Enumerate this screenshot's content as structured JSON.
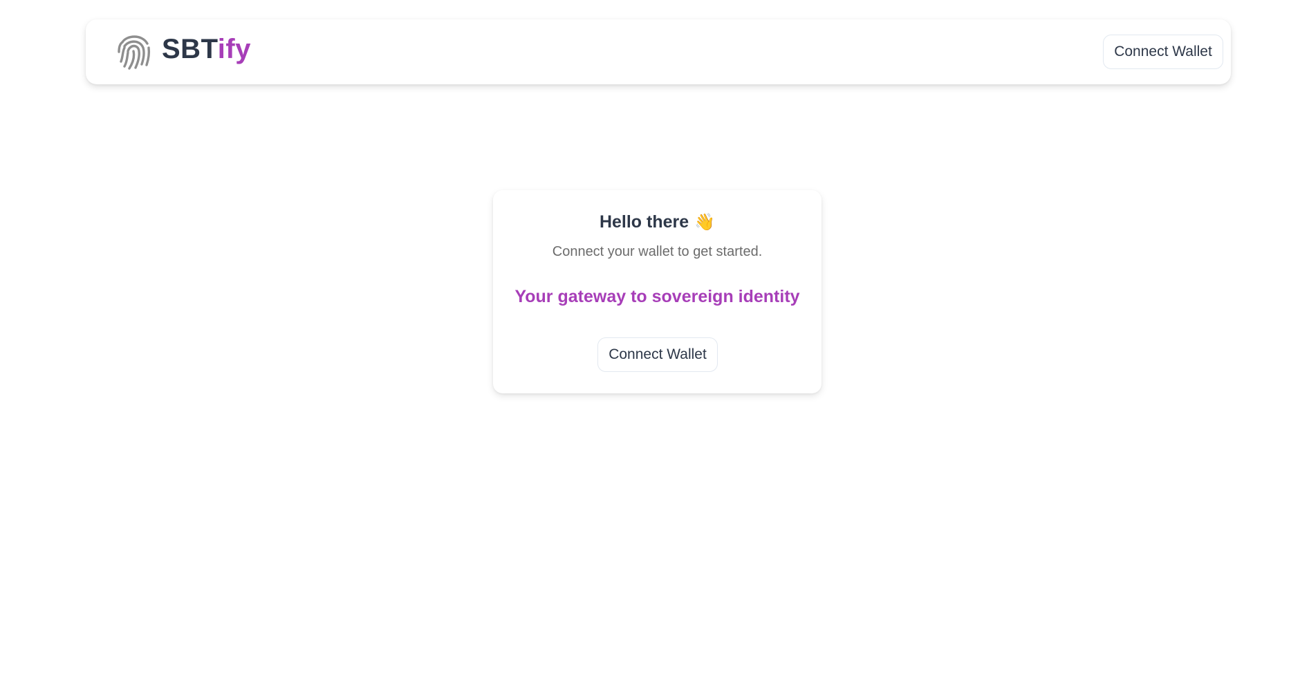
{
  "header": {
    "logo_icon": "fingerprint-icon",
    "brand_prefix": "SBT",
    "brand_suffix": "ify",
    "connect_wallet_label": "Connect Wallet"
  },
  "card": {
    "title": "Hello there",
    "title_emoji": "👋",
    "subtitle": "Connect your wallet to get started.",
    "tagline": "Your gateway to sovereign identity",
    "connect_wallet_label": "Connect Wallet"
  },
  "colors": {
    "brand_accent": "#a73eb8",
    "text_dark": "#2d3748",
    "text_muted": "#6b6b6b",
    "button_border": "#e2e8f0"
  }
}
